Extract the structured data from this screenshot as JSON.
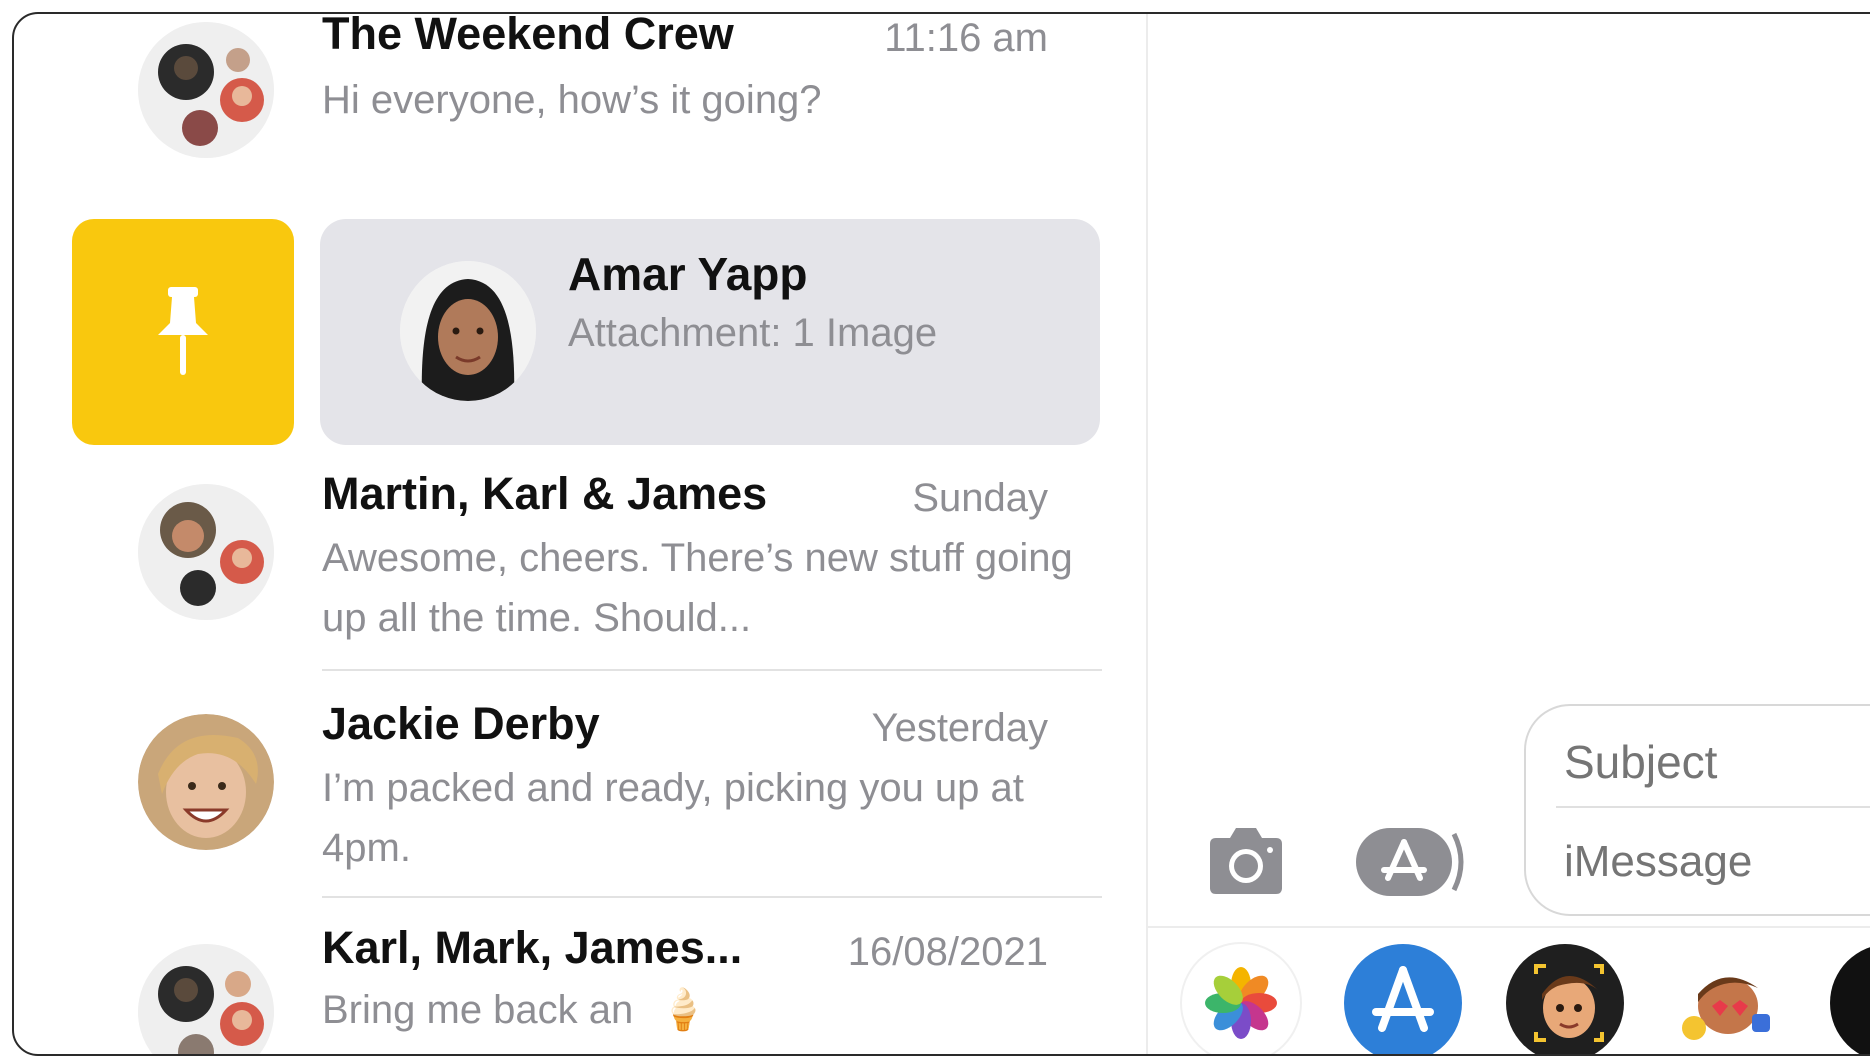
{
  "conversations": [
    {
      "name": "The Weekend Crew",
      "time": "11:16 am",
      "preview": "Hi everyone, how’s it going?"
    },
    {
      "name": "Martin, Karl & James",
      "time": "Sunday",
      "preview": "Awesome, cheers. There’s new stuff going up all the time. Should..."
    },
    {
      "name": "Jackie Derby",
      "time": "Yesterday",
      "preview": "I’m packed and ready, picking you up at 4pm."
    },
    {
      "name": "Karl, Mark, James...",
      "time": "16/08/2021",
      "preview": "Bring me back an",
      "emoji": "🍦"
    }
  ],
  "pinned": {
    "name": "Amar Yapp",
    "preview": "Attachment: 1 Image"
  },
  "composer": {
    "subject_placeholder": "Subject",
    "message_placeholder": "iMessage"
  },
  "colors": {
    "pin_action": "#f9c80e",
    "pinned_bg": "#e4e4e9",
    "secondary_text": "#8e8e93",
    "app_store_blue": "#2d7fd8"
  },
  "icons": {
    "pin": "pin-icon",
    "camera": "camera-icon",
    "apps": "app-store-icon",
    "app_drawer": [
      "photos-app-icon",
      "app-store-app-icon",
      "memoji-app-icon",
      "animoji-stickers-app-icon",
      "digital-touch-app-icon"
    ]
  }
}
